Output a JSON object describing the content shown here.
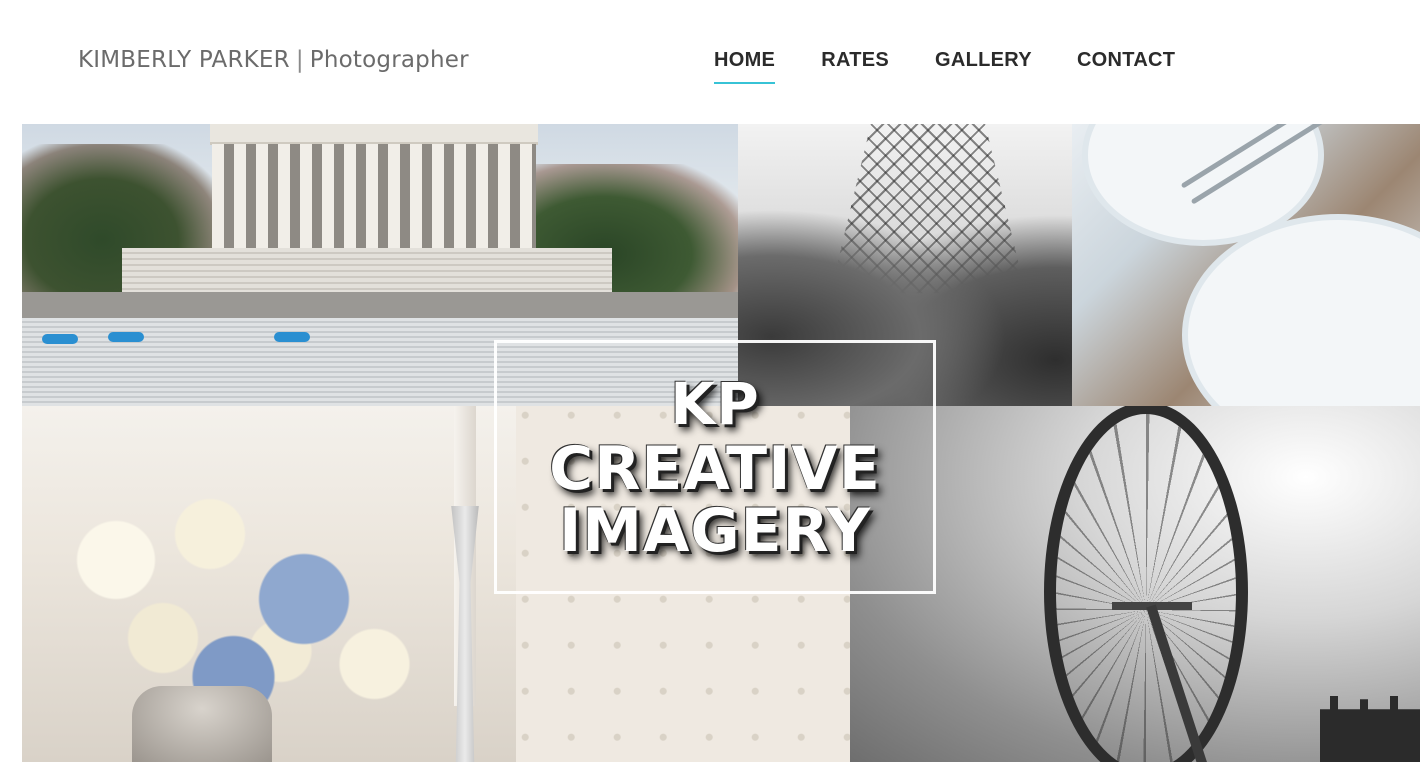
{
  "header": {
    "brand_name": "KIMBERLY PARKER",
    "brand_separator": "|",
    "brand_tagline": "Photographer",
    "nav": [
      {
        "label": "HOME",
        "active": true
      },
      {
        "label": "RATES",
        "active": false
      },
      {
        "label": "GALLERY",
        "active": false
      },
      {
        "label": "CONTACT",
        "active": false
      }
    ],
    "active_underline_color": "#37c3d6"
  },
  "hero": {
    "logo_lines": [
      "KP",
      "CREATIVE",
      "IMAGERY"
    ],
    "tiles": [
      {
        "name": "memorial-photo"
      },
      {
        "name": "eiffel-tower-photo"
      },
      {
        "name": "table-setting-photo"
      },
      {
        "name": "flowers-centerpiece-photo"
      },
      {
        "name": "ferris-wheel-photo"
      }
    ]
  }
}
